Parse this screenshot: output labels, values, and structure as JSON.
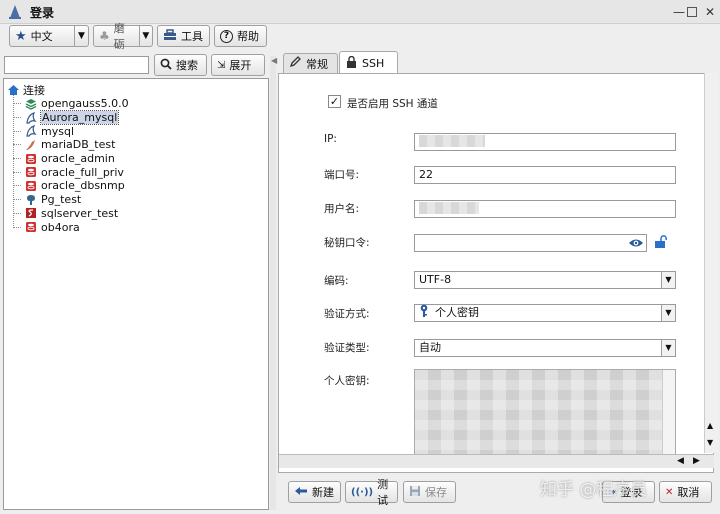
{
  "window": {
    "title": "登录"
  },
  "toolbar": {
    "language": "中文",
    "theme": "磨砺",
    "tools": "工具",
    "help": "帮助"
  },
  "search": {
    "placeholder": "",
    "search_btn": "搜索",
    "expand_btn": "展开"
  },
  "tree": {
    "root": "连接",
    "items": [
      {
        "label": "opengauss5.0.0",
        "icon": "layers-icon",
        "color": "#2e8b57"
      },
      {
        "label": "Aurora_mysql",
        "icon": "dolphin-icon",
        "color": "#3a5a8a",
        "selected": true
      },
      {
        "label": "mysql",
        "icon": "dolphin-icon",
        "color": "#3a5a8a"
      },
      {
        "label": "mariaDB_test",
        "icon": "seal-icon",
        "color": "#c0724a"
      },
      {
        "label": "oracle_admin",
        "icon": "database-icon",
        "color": "#d23030"
      },
      {
        "label": "oracle_full_priv",
        "icon": "database-icon",
        "color": "#d23030"
      },
      {
        "label": "oracle_dbsnmp",
        "icon": "database-icon",
        "color": "#d23030"
      },
      {
        "label": "Pg_test",
        "icon": "elephant-icon",
        "color": "#336791"
      },
      {
        "label": "sqlserver_test",
        "icon": "sqlserver-icon",
        "color": "#b22222"
      },
      {
        "label": "ob4ora",
        "icon": "database-icon",
        "color": "#d23030"
      }
    ]
  },
  "tabs": [
    {
      "label": "常规",
      "icon": "pencil-icon"
    },
    {
      "label": "SSH",
      "icon": "lock-icon"
    }
  ],
  "ssh": {
    "enable_label": "是否启用 SSH 通道",
    "ip_label": "IP:",
    "port_label": "端口号:",
    "port_value": "22",
    "user_label": "用户名:",
    "passphrase_label": "秘钥口令:",
    "encoding_label": "编码:",
    "encoding_value": "UTF-8",
    "auth_label": "验证方式:",
    "auth_value": "个人密钥",
    "authtype_label": "验证类型:",
    "authtype_value": "自动",
    "key_label": "个人密钥:"
  },
  "bottom": {
    "new_btn": "新建",
    "test_btn": "测试",
    "save_btn": "保存",
    "login_btn": "登录",
    "cancel_btn": "取消"
  },
  "watermark": "知乎 @程序员",
  "colors": {
    "accent": "#2a6fc9",
    "selection": "#cdd6e8"
  }
}
